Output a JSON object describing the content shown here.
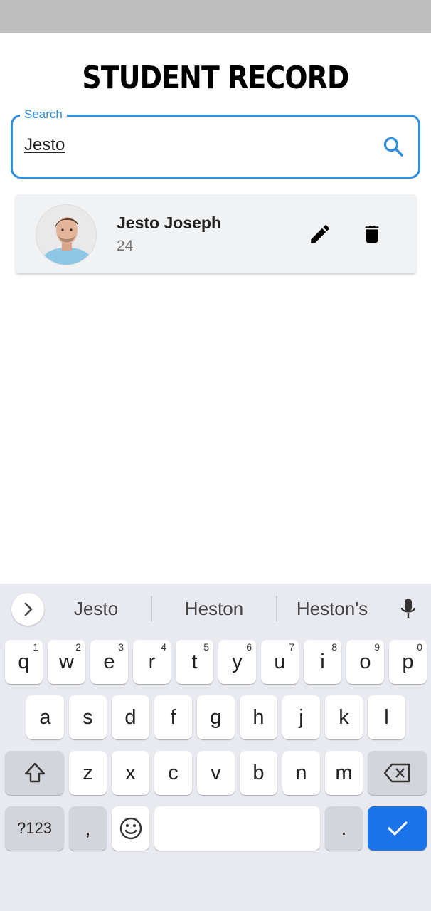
{
  "app": {
    "title": "STUDENT RECORD"
  },
  "search": {
    "label": "Search",
    "value": "Jesto"
  },
  "students": [
    {
      "name": "Jesto Joseph",
      "age": "24"
    }
  ],
  "keyboard": {
    "suggestions": [
      "Jesto",
      "Heston",
      "Heston's"
    ],
    "row1": [
      {
        "key": "q",
        "num": "1"
      },
      {
        "key": "w",
        "num": "2"
      },
      {
        "key": "e",
        "num": "3"
      },
      {
        "key": "r",
        "num": "4"
      },
      {
        "key": "t",
        "num": "5"
      },
      {
        "key": "y",
        "num": "6"
      },
      {
        "key": "u",
        "num": "7"
      },
      {
        "key": "i",
        "num": "8"
      },
      {
        "key": "o",
        "num": "9"
      },
      {
        "key": "p",
        "num": "0"
      }
    ],
    "row2": [
      "a",
      "s",
      "d",
      "f",
      "g",
      "h",
      "j",
      "k",
      "l"
    ],
    "row3": [
      "z",
      "x",
      "c",
      "v",
      "b",
      "n",
      "m"
    ],
    "symbols_label": "?123",
    "comma": ",",
    "period": "."
  },
  "colors": {
    "accent": "#2f8fdc",
    "enter_key": "#1a73e8"
  }
}
